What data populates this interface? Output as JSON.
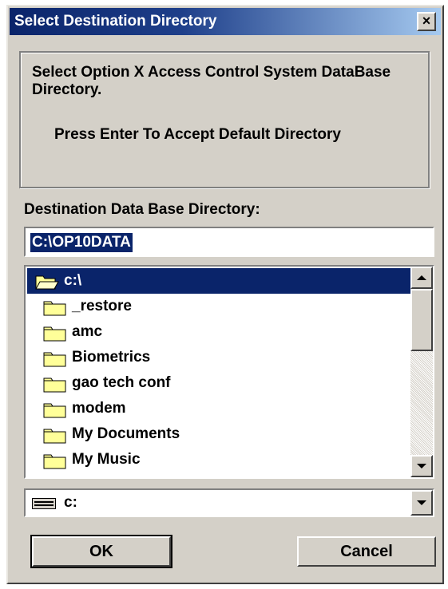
{
  "window": {
    "title": "Select Destination Directory",
    "close_label": "×"
  },
  "message": {
    "line1": "Select Option X Access Control System DataBase Directory.",
    "line2": "Press Enter To Accept Default Directory"
  },
  "destination": {
    "label": "Destination Data Base Directory:",
    "value": "C:\\OP10DATA"
  },
  "folder_list": {
    "items": [
      {
        "label": "c:\\",
        "icon": "open-folder-icon",
        "selected": true
      },
      {
        "label": "_restore",
        "icon": "folder-icon"
      },
      {
        "label": "amc",
        "icon": "folder-icon"
      },
      {
        "label": "Biometrics",
        "icon": "folder-icon"
      },
      {
        "label": "gao tech conf",
        "icon": "folder-icon"
      },
      {
        "label": "modem",
        "icon": "folder-icon"
      },
      {
        "label": "My Documents",
        "icon": "folder-icon"
      },
      {
        "label": "My Music",
        "icon": "folder-icon"
      }
    ]
  },
  "drive": {
    "value": "c:",
    "icon": "drive-icon"
  },
  "buttons": {
    "ok": "OK",
    "cancel": "Cancel"
  },
  "colors": {
    "selection": "#0a246a",
    "face": "#d4d0c8",
    "folder": "#ffff99"
  }
}
